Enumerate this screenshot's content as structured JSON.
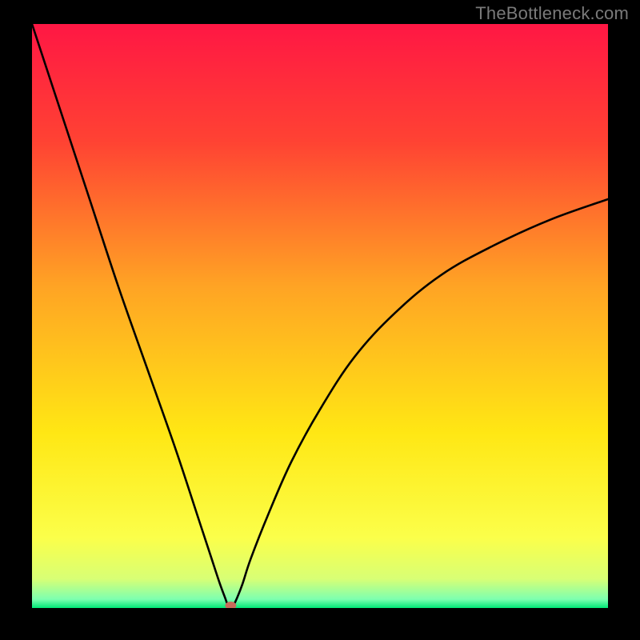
{
  "watermark": "TheBottleneck.com",
  "chart_data": {
    "type": "line",
    "title": "",
    "xlabel": "",
    "ylabel": "",
    "xlim": [
      0,
      100
    ],
    "ylim": [
      0,
      100
    ],
    "grid": false,
    "legend": false,
    "background_gradient": {
      "direction": "vertical",
      "stops": [
        {
          "pos": 0.0,
          "color": "#ff1744"
        },
        {
          "pos": 0.2,
          "color": "#ff4233"
        },
        {
          "pos": 0.45,
          "color": "#ffa424"
        },
        {
          "pos": 0.7,
          "color": "#ffe714"
        },
        {
          "pos": 0.88,
          "color": "#fbff4a"
        },
        {
          "pos": 0.95,
          "color": "#d8ff75"
        },
        {
          "pos": 0.985,
          "color": "#7dffb0"
        },
        {
          "pos": 1.0,
          "color": "#00e676"
        }
      ]
    },
    "series": [
      {
        "name": "bottleneck-curve",
        "x": [
          0,
          5,
          10,
          15,
          20,
          25,
          29,
          31,
          32.5,
          33.5,
          34,
          34.5,
          35,
          35.5,
          36.5,
          38,
          41,
          45,
          50,
          56,
          63,
          71,
          80,
          90,
          100
        ],
        "y": [
          100,
          85,
          70,
          55,
          41,
          27,
          15,
          9,
          4.5,
          1.8,
          0.5,
          0,
          0.5,
          1.5,
          4,
          8.5,
          16,
          25,
          34,
          43,
          50.5,
          57,
          62,
          66.5,
          70
        ]
      }
    ],
    "marker": {
      "name": "optimal-point",
      "x": 34.5,
      "y": 0,
      "color": "#c86a5b",
      "rx": 7,
      "ry": 5
    }
  }
}
